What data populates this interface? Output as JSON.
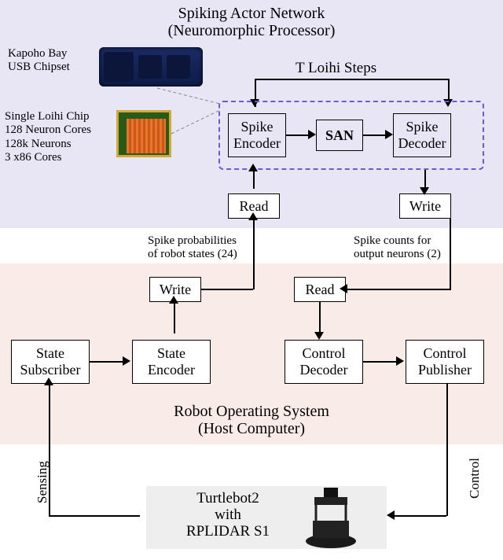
{
  "top": {
    "title_line1": "Spiking Actor Network",
    "title_line2": "(Neuromorphic Processor)",
    "hw1_line1": "Kapoho Bay",
    "hw1_line2": "USB Chipset",
    "hw2_line1": "Single Loihi Chip",
    "hw2_line2": "128 Neuron Cores",
    "hw2_line3": "128k Neurons",
    "hw2_line4": "3 x86 Cores",
    "loop_label": "T Loihi Steps",
    "spike_encoder": "Spike\nEncoder",
    "san": "SAN",
    "spike_decoder": "Spike\nDecoder",
    "read": "Read",
    "write": "Write"
  },
  "edges": {
    "left_label_l1": "Spike probabilities",
    "left_label_l2": "of robot states (24)",
    "right_label_l1": "Spike counts for",
    "right_label_l2": "output neurons (2)"
  },
  "mid": {
    "write": "Write",
    "read": "Read",
    "state_subscriber": "State\nSubscriber",
    "state_encoder": "State\nEncoder",
    "control_decoder": "Control\nDecoder",
    "control_publisher": "Control\nPublisher",
    "title_line1": "Robot Operating System",
    "title_line2": "(Host Computer)"
  },
  "sides": {
    "sensing": "Sensing",
    "control": "Control"
  },
  "bot": {
    "robot_l1": "Turtlebot2",
    "robot_l2": "with",
    "robot_l3": "RPLIDAR S1"
  }
}
